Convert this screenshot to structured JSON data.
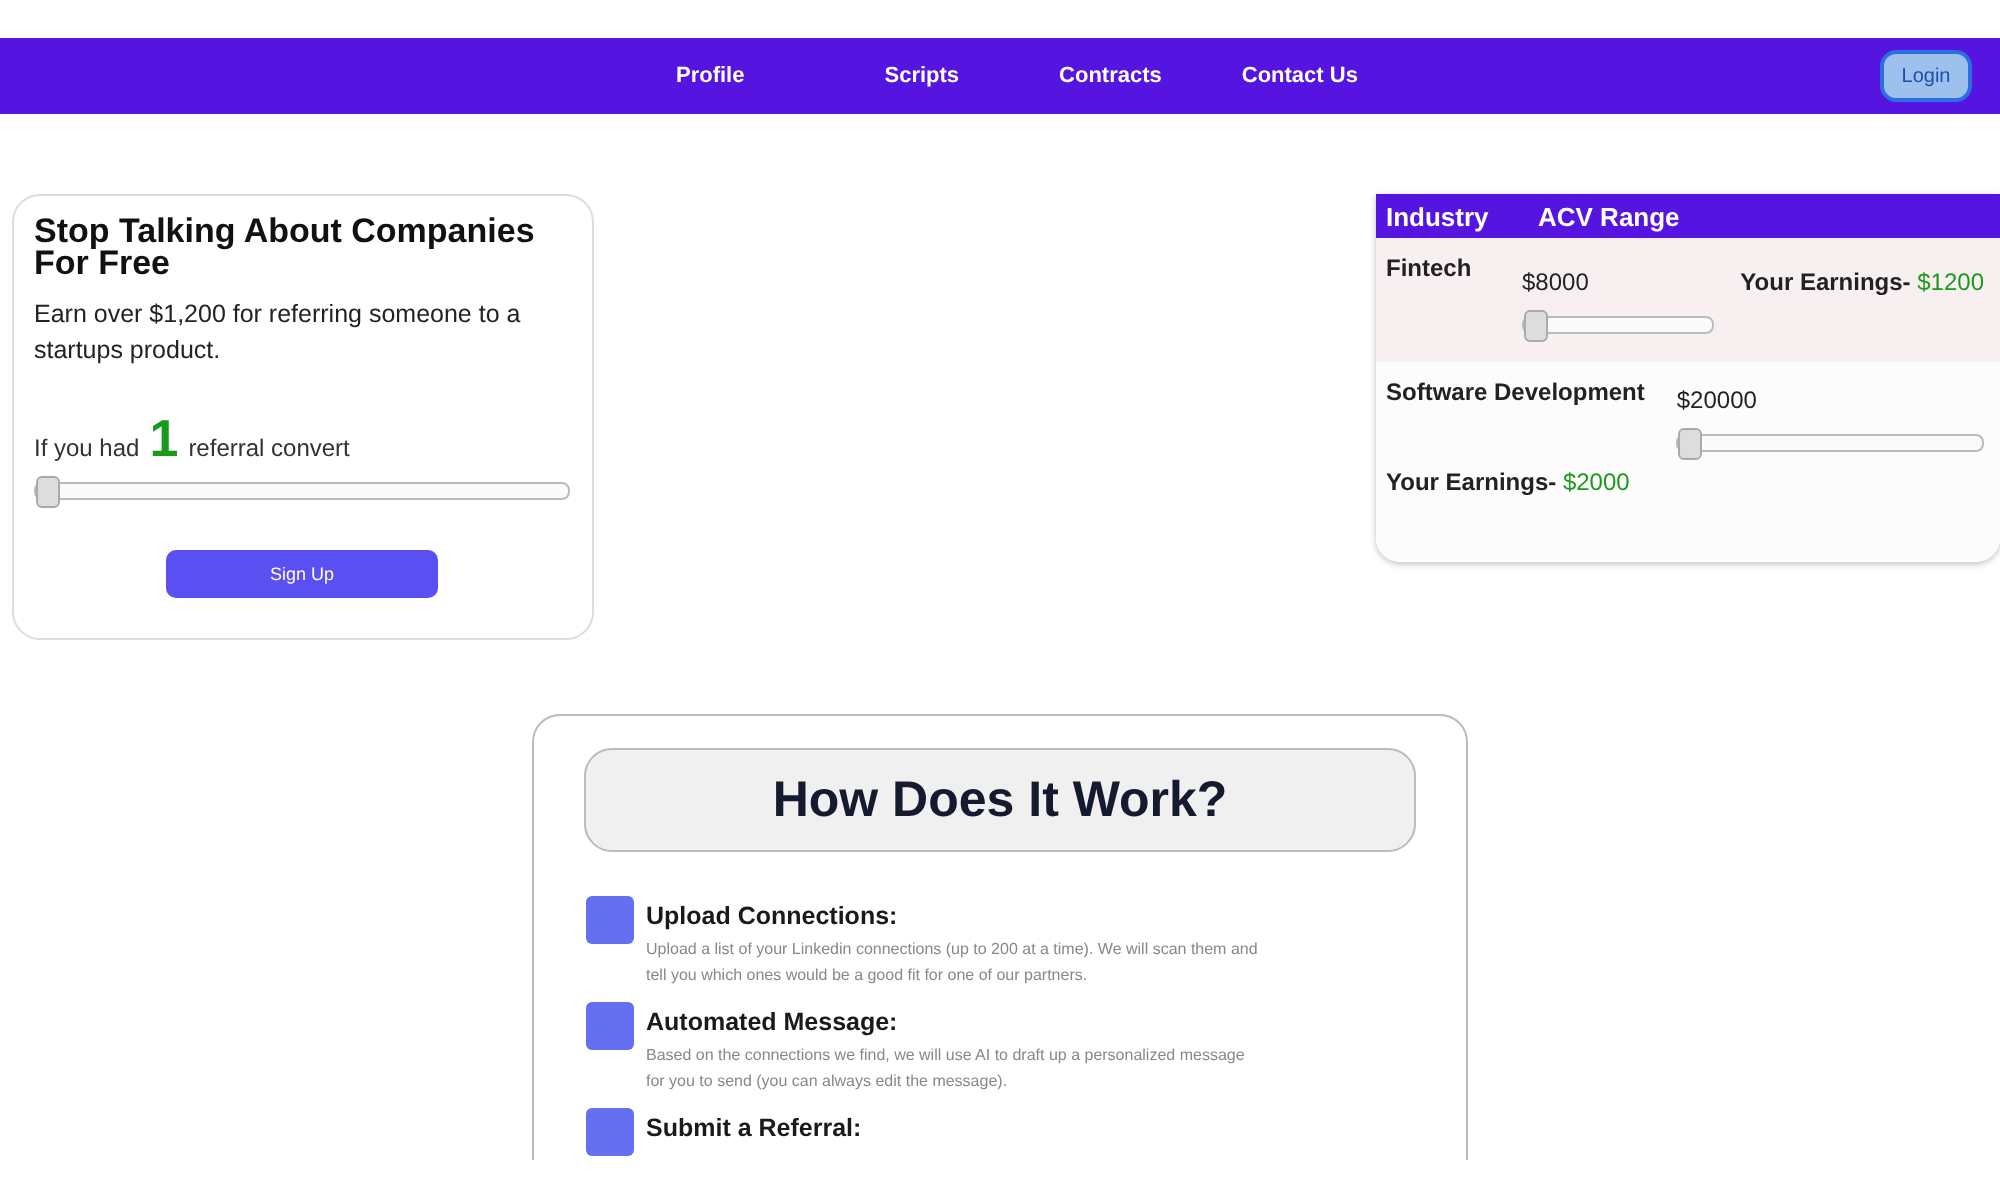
{
  "nav": {
    "links": [
      "Profile",
      "Scripts",
      "Contracts",
      "Contact Us"
    ],
    "login": "Login"
  },
  "promo": {
    "title": "Stop Talking About Companies For Free",
    "subtitle": "Earn over $1,200 for referring someone to a startups product.",
    "prefix": "If you had",
    "count": "1",
    "suffix": "referral convert",
    "slider": {
      "level": 0
    },
    "button": "Sign Up"
  },
  "table": {
    "columns": [
      "Industry",
      "ACV Range"
    ],
    "rows": [
      {
        "kind": "inline",
        "industry": "Fintech",
        "acv": "$8000",
        "level": 0,
        "earnings_label": "Your Earnings-",
        "earnings": "$1200"
      },
      {
        "kind": "stacked",
        "industry": "Software Development",
        "acv": "$20000",
        "level": 0,
        "earnings_label": "Your Earnings-",
        "earnings": "$2000"
      }
    ]
  },
  "how": {
    "title": "How Does It Work?",
    "steps": [
      {
        "title": "Upload Connections:",
        "text": "Upload a list of your Linkedin connections (up to 200 at a time). We will scan them and tell you which ones would be a good fit for one of our partners."
      },
      {
        "title": "Automated Message:",
        "text": "Based on the connections we find, we will use AI to draft up a personalized message for you to send (you can always edit the message)."
      },
      {
        "title": "Submit a Referral:"
      }
    ]
  }
}
